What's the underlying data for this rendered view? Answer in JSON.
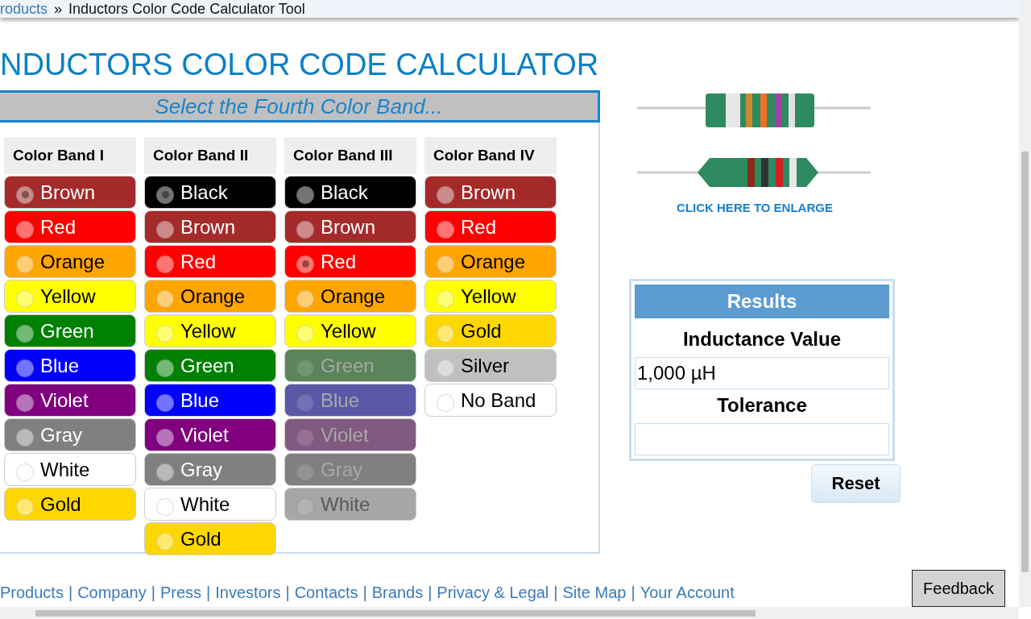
{
  "breadcrumb": {
    "link": "roducts",
    "separator": "»",
    "current": "Inductors Color Code Calculator Tool"
  },
  "title": "NDUCTORS COLOR CODE CALCULATOR",
  "panel": {
    "prompt": "Select the Fourth Color Band...",
    "columns": [
      {
        "heading": "Color Band I",
        "options": [
          {
            "label": "Brown",
            "color": "#a52a2a",
            "selected": true,
            "disabled": false
          },
          {
            "label": "Red",
            "color": "#ff0000",
            "selected": false,
            "disabled": false
          },
          {
            "label": "Orange",
            "color": "#ffa500",
            "selected": false,
            "disabled": false
          },
          {
            "label": "Yellow",
            "color": "#ffff00",
            "selected": false,
            "disabled": false
          },
          {
            "label": "Green",
            "color": "#008000",
            "selected": false,
            "disabled": false
          },
          {
            "label": "Blue",
            "color": "#0000ff",
            "selected": false,
            "disabled": false
          },
          {
            "label": "Violet",
            "color": "#800080",
            "selected": false,
            "disabled": false
          },
          {
            "label": "Gray",
            "color": "#808080",
            "selected": false,
            "disabled": false
          },
          {
            "label": "White",
            "color": "#ffffff",
            "selected": false,
            "disabled": false
          },
          {
            "label": "Gold",
            "color": "#ffd700",
            "selected": false,
            "disabled": false
          }
        ]
      },
      {
        "heading": "Color Band II",
        "options": [
          {
            "label": "Black",
            "color": "#000000",
            "selected": true,
            "disabled": false
          },
          {
            "label": "Brown",
            "color": "#a52a2a",
            "selected": false,
            "disabled": false
          },
          {
            "label": "Red",
            "color": "#ff0000",
            "selected": false,
            "disabled": false
          },
          {
            "label": "Orange",
            "color": "#ffa500",
            "selected": false,
            "disabled": false
          },
          {
            "label": "Yellow",
            "color": "#ffff00",
            "selected": false,
            "disabled": false
          },
          {
            "label": "Green",
            "color": "#008000",
            "selected": false,
            "disabled": false
          },
          {
            "label": "Blue",
            "color": "#0000ff",
            "selected": false,
            "disabled": false
          },
          {
            "label": "Violet",
            "color": "#800080",
            "selected": false,
            "disabled": false
          },
          {
            "label": "Gray",
            "color": "#808080",
            "selected": false,
            "disabled": false
          },
          {
            "label": "White",
            "color": "#ffffff",
            "selected": false,
            "disabled": false
          },
          {
            "label": "Gold",
            "color": "#ffd700",
            "selected": false,
            "disabled": false
          }
        ]
      },
      {
        "heading": "Color Band III",
        "options": [
          {
            "label": "Black",
            "color": "#000000",
            "selected": false,
            "disabled": false
          },
          {
            "label": "Brown",
            "color": "#a52a2a",
            "selected": false,
            "disabled": false
          },
          {
            "label": "Red",
            "color": "#ff0000",
            "selected": true,
            "disabled": false
          },
          {
            "label": "Orange",
            "color": "#ffa500",
            "selected": false,
            "disabled": false
          },
          {
            "label": "Yellow",
            "color": "#ffff00",
            "selected": false,
            "disabled": false
          },
          {
            "label": "Green",
            "color": "#5a8459",
            "selected": false,
            "disabled": true
          },
          {
            "label": "Blue",
            "color": "#5a59a8",
            "selected": false,
            "disabled": true
          },
          {
            "label": "Violet",
            "color": "#805a80",
            "selected": false,
            "disabled": true
          },
          {
            "label": "Gray",
            "color": "#808080",
            "selected": false,
            "disabled": true
          },
          {
            "label": "White",
            "color": "#a6a6a6",
            "selected": false,
            "disabled": true
          }
        ]
      },
      {
        "heading": "Color Band IV",
        "options": [
          {
            "label": "Brown",
            "color": "#a52a2a",
            "selected": false,
            "disabled": false
          },
          {
            "label": "Red",
            "color": "#ff0000",
            "selected": false,
            "disabled": false
          },
          {
            "label": "Orange",
            "color": "#ffa500",
            "selected": false,
            "disabled": false
          },
          {
            "label": "Yellow",
            "color": "#ffff00",
            "selected": false,
            "disabled": false
          },
          {
            "label": "Gold",
            "color": "#ffd700",
            "selected": false,
            "disabled": false
          },
          {
            "label": "Silver",
            "color": "#c0c0c0",
            "selected": false,
            "disabled": false
          },
          {
            "label": "No Band",
            "color": "#ffffff",
            "selected": false,
            "disabled": false
          }
        ]
      }
    ]
  },
  "diagram": {
    "link": "CLICK HERE TO ENLARGE"
  },
  "results": {
    "title": "Results",
    "fields": [
      {
        "label": "Inductance Value",
        "value": "1,000 µH"
      },
      {
        "label": "Tolerance"
      }
    ],
    "reset": "Reset"
  },
  "footer_links": [
    {
      "label": "Products"
    },
    {
      "separator": "|",
      "label": "Company"
    },
    {
      "separator": "|",
      "label": "Press"
    },
    {
      "separator": "|",
      "label": "Investors"
    },
    {
      "separator": "|",
      "label": "Contacts"
    },
    {
      "separator": "|",
      "label": "Brands"
    },
    {
      "separator": "|",
      "label": "Privacy & Legal"
    },
    {
      "separator": "|",
      "label": "Site Map"
    },
    {
      "separator": "|",
      "label": "Your Account"
    }
  ],
  "feedback": "Feedback"
}
